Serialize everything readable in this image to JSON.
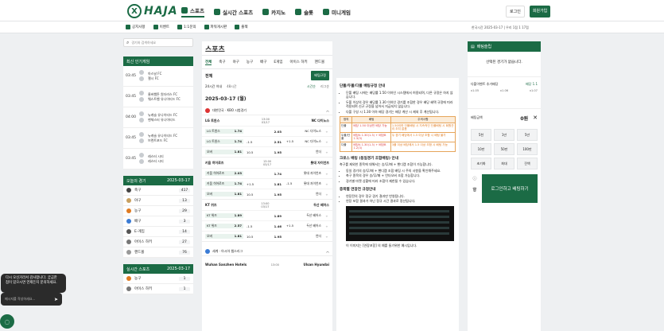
{
  "brand": {
    "logo_mark": "X",
    "logo_text": "HAJA"
  },
  "mainnav": [
    {
      "label": "스포츠",
      "icon": "trophy-icon",
      "active": true
    },
    {
      "label": "실시간 스포츠",
      "icon": "live-icon",
      "active": false
    },
    {
      "label": "카지노",
      "icon": "casino-icon",
      "active": false
    },
    {
      "label": "슬롯",
      "icon": "slot-icon",
      "active": false
    },
    {
      "label": "미니게임",
      "icon": "rocket-icon",
      "active": false
    }
  ],
  "auth": {
    "login": "로그인",
    "join": "회원가입"
  },
  "subnav": [
    "공지사항",
    "이벤트",
    "1:1문의",
    "파워게시판",
    "출첵"
  ],
  "subright": "한국시간 2025-03-17 | 우리 1점 1 17점",
  "search": {
    "placeholder": "경기와 검색하세요"
  },
  "popular": {
    "title": "최신 인기게임",
    "games": [
      {
        "time": "03:45",
        "home": "아스날 FC",
        "away": "첼시 FC"
      },
      {
        "time": "03:45",
        "home": "울버햄튼 원더러스 FC",
        "away": "웨스트햄 유나이티드 FC"
      },
      {
        "time": "04:00",
        "home": "뉴캐슬 유나이티드 FC",
        "away": "맨체스터 유나이티드"
      },
      {
        "time": "03:45",
        "home": "뉴캐슬 유나이티드 FC",
        "away": "브렌트포드 FC"
      },
      {
        "time": "03:45",
        "home": "레스터 시티",
        "away": "레스터 시티"
      }
    ]
  },
  "today": {
    "title": "오늘의 경기",
    "date": "2025-03-17",
    "sports": [
      {
        "name": "축구",
        "count": "417",
        "color": "#444"
      },
      {
        "name": "야구",
        "count": "13",
        "color": "#c8a060"
      },
      {
        "name": "농구",
        "count": "29",
        "color": "#e07a20"
      },
      {
        "name": "배구",
        "count": "3",
        "color": "#3a7bd5"
      },
      {
        "name": "E-게임",
        "count": "14",
        "color": "#555"
      },
      {
        "name": "아이스 하키",
        "count": "27",
        "color": "#777"
      },
      {
        "name": "핸드볼",
        "count": "76",
        "color": "#999"
      }
    ]
  },
  "live": {
    "title": "실시간 스포츠",
    "date": "2025-03-17",
    "sports": [
      {
        "name": "농구",
        "count": "1",
        "color": "#e07a20"
      },
      {
        "name": "아이스 하키",
        "count": "1",
        "color": "#777"
      }
    ]
  },
  "center": {
    "title": "스포츠",
    "tabs": [
      "전체",
      "축구",
      "야구",
      "농구",
      "배구",
      "E게임",
      "아이스 하키",
      "핸드볼"
    ],
    "filter_label": "전체",
    "filter_btn": "배팅규정",
    "sub_left": [
      "24시간 이내",
      "48시간"
    ],
    "sub_right": [
      "시간순",
      "리그순"
    ],
    "date": "2025-03-17 (월)",
    "league": "대한민국 · KBO 시범경기",
    "matches": [
      {
        "home": "LG 트윈스",
        "away": "NC 다이노스",
        "time": "13:00",
        "sub": "03/17",
        "rows": [
          {
            "h": "LG 트윈스",
            "hv": "1.74",
            "d": "",
            "dv": "2.03",
            "a": "NC 다이노스",
            "av": ""
          },
          {
            "h": "LG 트윈스",
            "hv": "1.74",
            "d": "-1.5",
            "dv": "2.51",
            "a": "NC 다이노스",
            "av": "+1.5"
          },
          {
            "h": "오버",
            "hv": "1.81",
            "d": "10.5",
            "dv": "1.95",
            "a": "언더",
            "av": ""
          }
        ]
      },
      {
        "home": "키움 히어로즈",
        "away": "롯데 자이언츠",
        "time": "13:00",
        "sub": "03/17",
        "rows": [
          {
            "h": "키움 히어로즈",
            "hv": "2.03",
            "d": "",
            "dv": "1.74",
            "a": "롯데 자이언츠",
            "av": ""
          },
          {
            "h": "키움 히어로즈",
            "hv": "1.74",
            "d": "+1.5",
            "dv": "1.81",
            "a": "롯데 자이언츠",
            "av": "-1.5"
          },
          {
            "h": "오버",
            "hv": "1.81",
            "d": "10.5",
            "dv": "1.95",
            "a": "언더",
            "av": ""
          }
        ]
      },
      {
        "home": "KT 위즈",
        "away": "두산 베어스",
        "time": "13:00",
        "sub": "03/17",
        "rows": [
          {
            "h": "KT 위즈",
            "hv": "1.89",
            "d": "",
            "dv": "1.89",
            "a": "두산 베어스",
            "av": ""
          },
          {
            "h": "KT 위즈",
            "hv": "2.57",
            "d": "-1.5",
            "dv": "1.46",
            "a": "두산 베어스",
            "av": "+1.5"
          },
          {
            "h": "오버",
            "hv": "1.81",
            "d": "10.5",
            "dv": "1.95",
            "a": "언더",
            "av": ""
          }
        ]
      }
    ],
    "league2": "세계 · 아시아 챔스리그",
    "match4": {
      "home": "Wuhan Sanzhen Hotels",
      "away": "Ulsan Hyundai",
      "time": "13:00"
    }
  },
  "rules": {
    "title1": "단폴/두폴/다폴 배팅규정 안내",
    "items1": [
      "단폴 배팅 시에는 배당률 1.50 이하인 시스템에서 허용되며, 다른 규정은 하지 않습니다.",
      "두폴 이상의 경우 배당률 1.30 이하인 경기를 조합한 경우 배당 혜택 규정에 따라 적용되며 신규 규정을 넘어서 지급되지 않습니다.",
      "다폴 구성 시 1.30 이하 배당 경기는 배당 계산 시 제외 후 계산됩니다."
    ],
    "table_head": [
      "정의",
      "배팅",
      "주의사항"
    ],
    "table_rows": [
      {
        "k": "단폴",
        "v": "배당 1.50 이상만 배당 가능",
        "n": "1.50이하 단폴배팅 시 지속적인 단폴배팅 시 회원관리 조치 없음"
      },
      {
        "k": "두폴/단폴",
        "v": "배당A 1.30(1.3) + 배당B 1.3(3)",
        "n": "두 경기 배당에서 1.5 이상 조합 시 배팅 불가"
      },
      {
        "k": "다폴",
        "v": "배당A 1.30(1.3) + 배당B 1.2(3)",
        "n": "3폴 이상 배당에서 1.5 이상 조합 시 배팅 가능"
      }
    ],
    "title2": "크로스 배팅 (동일경기 조합배팅) 안내",
    "p2": "축구를 제외한 종목에 대해서는 승/무/패 + 핸디캡 조합이 가능합니다.",
    "items2": [
      "동일 경기의 승/무/패 + 핸디캡 조합 배팅 시 주의 사항을 확인해주세요.",
      "축구 종목의 경우 승/무/패 + 언더오버 조합 가능합니다.",
      "경기별 마켓 상황에 따라 조합이 제한될 수 있습니다."
    ],
    "title3": "종목별 연장전 규정안내",
    "items3": [
      "연장전의 경우 정규 경기 결과만 반영됩니다.",
      "연장 포함 결과가 아닌 정규 시간 결과로 정산됩니다."
    ],
    "footer": "이 이미지는 [연장포함] 의 예를 들기위한 예시입니다."
  },
  "slip": {
    "title": "배팅슬립",
    "empty": "선택된 경기가 없습니다.",
    "bonus_label": "다폴이벤트 추가배당",
    "bonus_value": "배당 1.1",
    "bonus_sub": [
      "x1.05",
      "x1.06",
      "x1.07"
    ],
    "amount_label": "배팅금액",
    "amount_value": "0원",
    "chips": [
      "5천",
      "1만",
      "5만",
      "10만",
      "50만",
      "100만",
      "초기화",
      "최대",
      "잔액"
    ],
    "submit": "로그인하고 배팅하기"
  },
  "chat": {
    "message": "다시 오신거라서 감사합니다. 궁금한 점이 있으시면 언제든지 문의하세요.",
    "placeholder": "메시지를 작성하세요..."
  }
}
